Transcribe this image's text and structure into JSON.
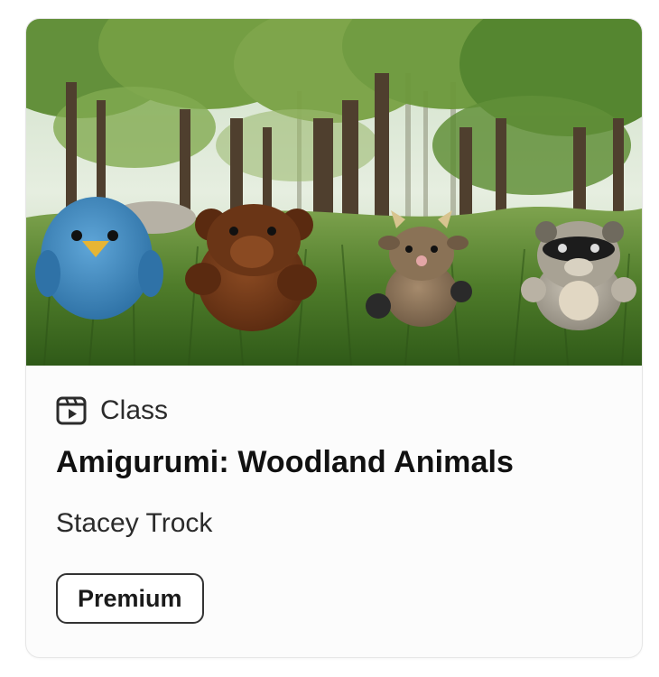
{
  "card": {
    "image_alt": "Crocheted woodland animals in a forest",
    "type_icon": "video-play-icon",
    "type_label": "Class",
    "title": "Amigurumi: Woodland Animals",
    "author": "Stacey Trock",
    "badge": "Premium"
  },
  "colors": {
    "border": "#e6e6e6",
    "text_primary": "#111111",
    "text_secondary": "#2b2b2b",
    "badge_border": "#333333"
  }
}
